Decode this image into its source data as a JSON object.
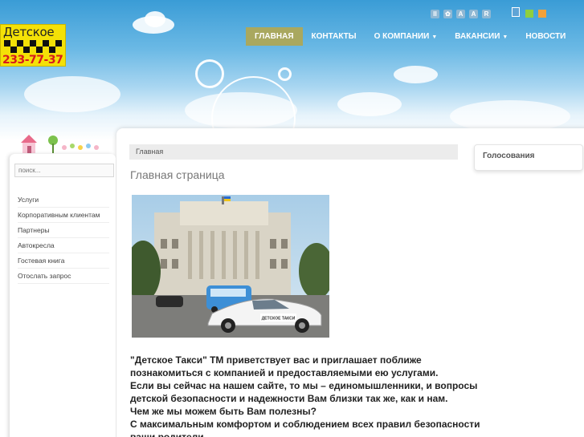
{
  "logo": {
    "title": "Детское",
    "phone": "233-77-37"
  },
  "tools": [
    "II",
    "✿",
    "A",
    "A",
    "R"
  ],
  "nav": [
    {
      "label": "ГЛАВНАЯ",
      "active": true,
      "dropdown": false
    },
    {
      "label": "КОНТАКТЫ",
      "active": false,
      "dropdown": false
    },
    {
      "label": "О КОМПАНИИ",
      "active": false,
      "dropdown": true
    },
    {
      "label": "ВАКАНСИИ",
      "active": false,
      "dropdown": true
    },
    {
      "label": "НОВОСТИ",
      "active": false,
      "dropdown": false
    }
  ],
  "search": {
    "placeholder": "поиск..."
  },
  "sidebar": {
    "items": [
      {
        "label": "Услуги"
      },
      {
        "label": "Корпоративным клиентам"
      },
      {
        "label": "Партнеры"
      },
      {
        "label": "Автокресла"
      },
      {
        "label": "Гостевая книга"
      },
      {
        "label": "Отослать запрос"
      }
    ]
  },
  "breadcrumb": "Главная",
  "page_title": "Главная страница",
  "taxi_sign": "ДЕТСКОЕ ТАКСИ",
  "article": {
    "lines": [
      "\"Детское Такси\" ТМ приветствует вас и приглашает поближе",
      "познакомиться с компанией и предоставляемыми ею услугами.",
      " Если вы сейчас  на нашем сайте, то мы – единомышленники, и вопросы",
      "детской безопасности  и надежности Вам близки так же, как и нам.",
      " Чем же мы можем быть Вам полезны?",
      " С максимальным комфортом и соблюдением всех правил безопасности",
      "ваши родители"
    ]
  },
  "right_panel": {
    "title": "Голосования"
  },
  "colors": {
    "nav_active": "#a9a85f",
    "logo_bg": "#f4e107",
    "phone": "#d81b1b"
  }
}
